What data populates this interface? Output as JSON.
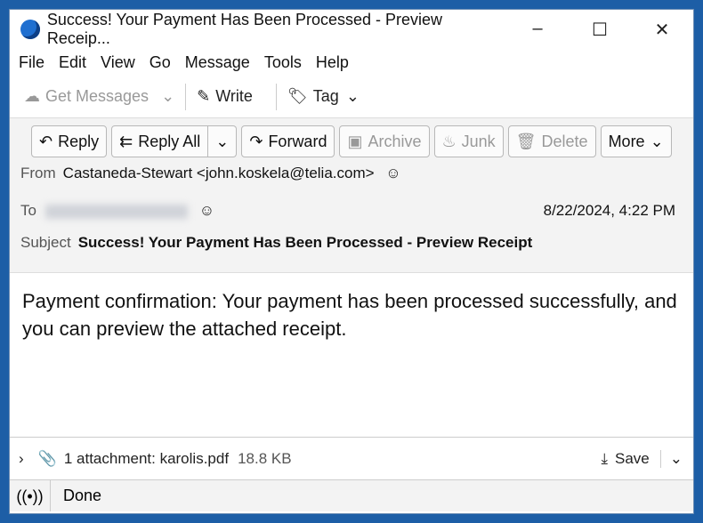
{
  "window": {
    "title": "Success! Your Payment Has Been Processed - Preview Receip...",
    "controls": [
      "–",
      "☐",
      "✕"
    ]
  },
  "menu": [
    "File",
    "Edit",
    "View",
    "Go",
    "Message",
    "Tools",
    "Help"
  ],
  "toolbar": {
    "get_messages": "Get Messages",
    "write": "Write",
    "tag": "Tag"
  },
  "actions": {
    "reply": "Reply",
    "reply_all": "Reply All",
    "forward": "Forward",
    "archive": "Archive",
    "junk": "Junk",
    "delete": "Delete",
    "more": "More"
  },
  "header": {
    "from_label": "From",
    "from_value": "Castaneda-Stewart <john.koskela@telia.com>",
    "to_label": "To",
    "date": "8/22/2024, 4:22 PM",
    "subject_label": "Subject",
    "subject": "Success! Your Payment Has Been Processed - Preview Receipt"
  },
  "body": {
    "text": "Payment confirmation: Your payment has been processed successfully, and you can preview the attached receipt."
  },
  "attachment": {
    "label": "1 attachment: karolis.pdf",
    "size": "18.8 KB",
    "save": "Save"
  },
  "status": {
    "text": "Done"
  }
}
